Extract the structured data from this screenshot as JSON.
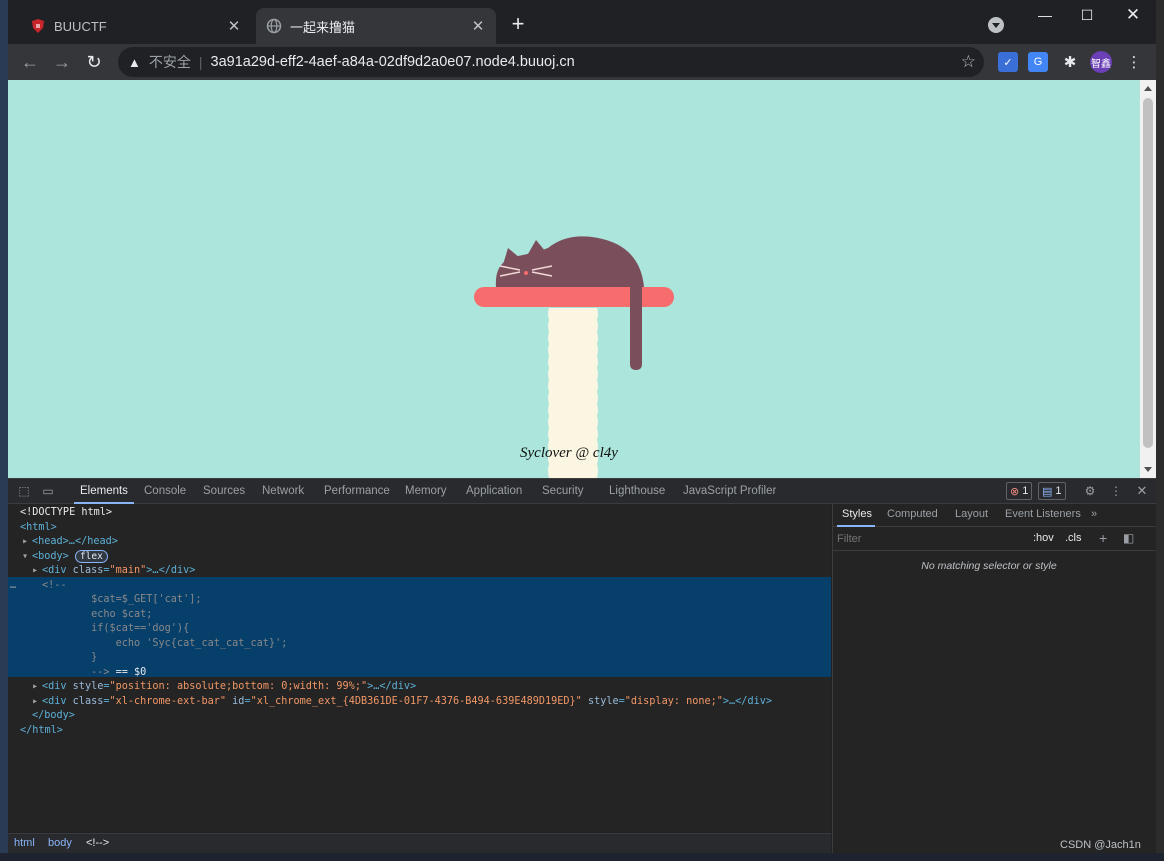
{
  "browser": {
    "tabs": [
      {
        "title": "BUUCTF",
        "favicon": "buuctf-icon",
        "active": false
      },
      {
        "title": "一起来撸猫",
        "favicon": "globe-icon",
        "active": true
      }
    ],
    "address": {
      "security_label": "不安全",
      "separator": "|",
      "url": "3a91a29d-eff2-4aef-a84a-02df9d2a0e07.node4.buuoj.cn"
    },
    "profile_label": "智鑫"
  },
  "page": {
    "background_color": "#abe5dc",
    "signature": "Syclover @ cl4y"
  },
  "devtools": {
    "tabs": [
      "Elements",
      "Console",
      "Sources",
      "Network",
      "Performance",
      "Memory",
      "Application",
      "Security",
      "Lighthouse",
      "JavaScript Profiler"
    ],
    "active_tab": "Elements",
    "error_count": "1",
    "message_count": "1",
    "dom": {
      "doctype": "<!DOCTYPE html>",
      "html_open": "<html>",
      "head": "<head>…</head>",
      "body_open": "<body>",
      "flex_badge": "flex",
      "div_main_tag": "<div ",
      "div_main_attr": "class",
      "div_main_val": "\"main\"",
      "div_main_close": ">…</div>",
      "comment_lines": [
        "<!--",
        "        $cat=$_GET['cat'];",
        "        echo $cat;",
        "        if($cat=='dog'){",
        "            echo 'Syc{cat_cat_cat_cat}';",
        "        }",
        "        -->"
      ],
      "comment_eq": " == $0",
      "div_style_attr": "style",
      "div_style_val": "\"position: absolute;bottom: 0;width: 99%;\"",
      "div_ext_class_val": "\"xl-chrome-ext-bar\"",
      "div_ext_id_attr": "id",
      "div_ext_id_val": "\"xl_chrome_ext_{4DB361DE-01F7-4376-B494-639E489D19ED}\"",
      "div_ext_style_val": "\"display: none;\"",
      "body_close": "</body>",
      "html_close": "</html>"
    },
    "breadcrumbs": [
      "html",
      "body",
      "<!-->"
    ],
    "styles_tabs": [
      "Styles",
      "Computed",
      "Layout",
      "Event Listeners"
    ],
    "styles_active": "Styles",
    "filter_placeholder": "Filter",
    "hov_label": ":hov",
    "cls_label": ".cls",
    "no_match_text": "No matching selector or style"
  },
  "watermark": "CSDN @Jach1n"
}
